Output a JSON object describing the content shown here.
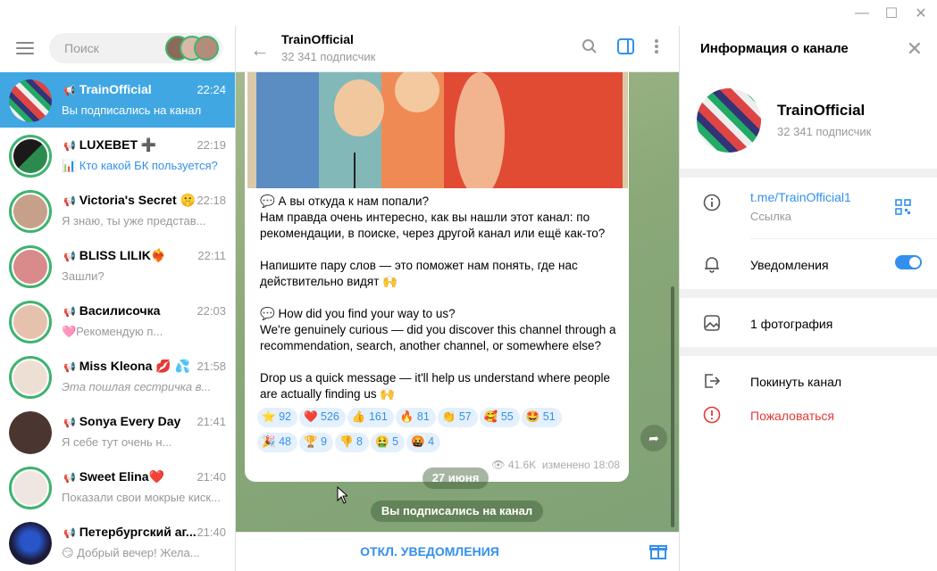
{
  "window": {
    "minimize": "—",
    "maximize": "☐",
    "close": "✕"
  },
  "search": {
    "placeholder": "Поиск"
  },
  "chats": [
    {
      "title": "TrainOfficial",
      "time": "22:24",
      "preview": "Вы подписались на канал",
      "active": true
    },
    {
      "title": "LUXEBET ➕",
      "time": "22:19",
      "preview": "📊 Кто какой БК пользуется?"
    },
    {
      "title": "Victoria's Secret 🤫",
      "time": "22:18",
      "preview": "Я знаю, ты уже представ..."
    },
    {
      "title": "BLISS LILIK❤️‍🔥",
      "time": "22:11",
      "preview": "Зашли?"
    },
    {
      "title": "Василисочка",
      "time": "22:03",
      "preview": "🩷Рекомендую п..."
    },
    {
      "title": "Miss Kleona 💋 💦",
      "time": "21:58",
      "preview": "Эта пошлая сестричка в..."
    },
    {
      "title": "Sonya Every Day",
      "time": "21:41",
      "preview": "Я себе тут очень н..."
    },
    {
      "title": "Sweet Elina❤️",
      "time": "21:40",
      "preview": "Показали свои мокрые киск..."
    },
    {
      "title": "Петербургский аг...",
      "time": "21:40",
      "preview": "😏 Добрый вечер! Жела..."
    }
  ],
  "channel": {
    "name": "TrainOfficial",
    "subscribers": "32 341 подписчик"
  },
  "message": {
    "para1_head": "💬 А вы откуда к нам попали?",
    "para1": "Нам правда очень интересно, как вы нашли этот канал: по рекомендации, в поиске, через другой канал или ещё как-то?",
    "para2": "Напишите пару слов — это поможет нам понять, где нас действительно видят 🙌",
    "para3_head": "💬 How did you find your way to us?",
    "para3": "We're genuinely curious — did you discover this channel through a recommendation, search, another channel, or somewhere else?",
    "para4": "Drop us a quick message — it'll help us understand where people are actually finding us 🙌",
    "views": "👁 41.6K",
    "edited": "изменено 18:08"
  },
  "reactions": [
    {
      "emoji": "⭐",
      "count": "92"
    },
    {
      "emoji": "❤️",
      "count": "526"
    },
    {
      "emoji": "👍",
      "count": "161"
    },
    {
      "emoji": "🔥",
      "count": "81"
    },
    {
      "emoji": "👏",
      "count": "57"
    },
    {
      "emoji": "🥰",
      "count": "55"
    },
    {
      "emoji": "🤩",
      "count": "51"
    },
    {
      "emoji": "🎉",
      "count": "48"
    },
    {
      "emoji": "🏆",
      "count": "9"
    },
    {
      "emoji": "👎",
      "count": "8"
    },
    {
      "emoji": "🤮",
      "count": "5"
    },
    {
      "emoji": "🤬",
      "count": "4"
    }
  ],
  "date_pill": "27 июня",
  "service_msg": "Вы подписались на канал",
  "footer": {
    "mute": "ОТКЛ. УВЕДОМЛЕНИЯ"
  },
  "info": {
    "header": "Информация о канале",
    "link": "t.me/TrainOfficial1",
    "link_label": "Ссылка",
    "notifications": "Уведомления",
    "photos": "1 фотография",
    "leave": "Покинуть канал",
    "report": "Пожаловаться"
  },
  "colors": {
    "accent": "#3390ec",
    "active": "#40a7e3",
    "ring": "#3fb370"
  }
}
